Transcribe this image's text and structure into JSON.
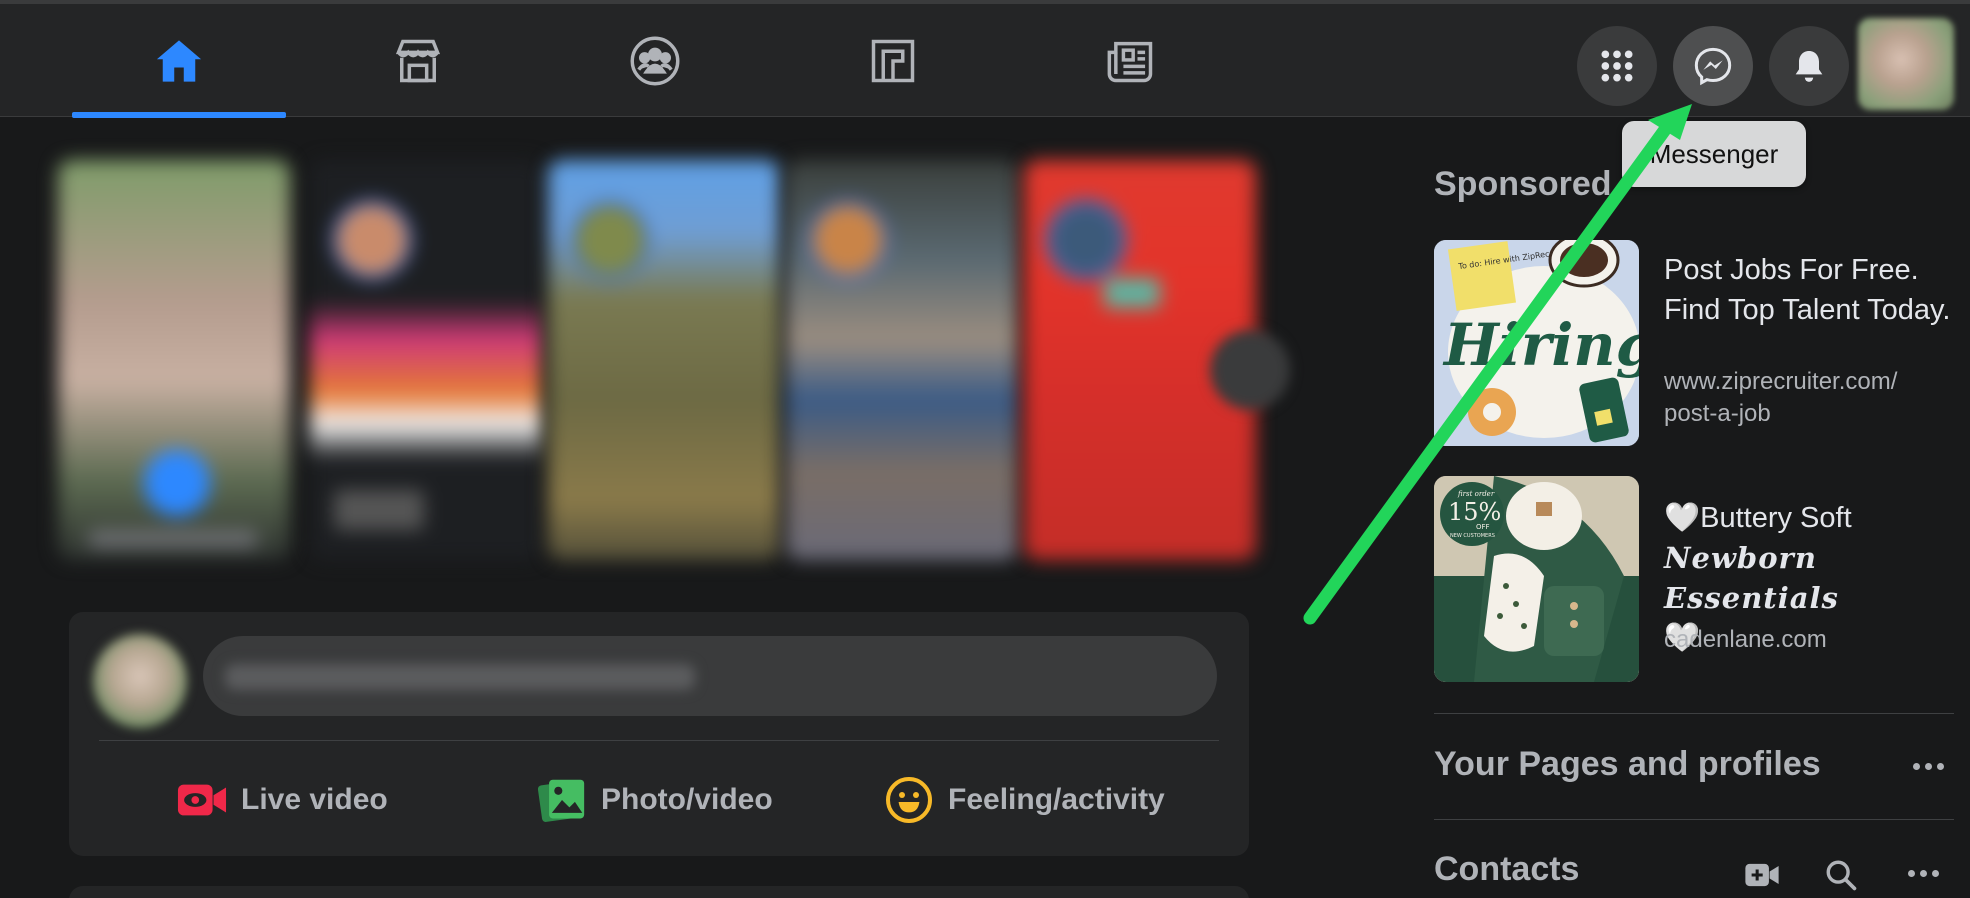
{
  "nav": {
    "tabs": [
      {
        "name": "home",
        "active": true
      },
      {
        "name": "marketplace",
        "active": false
      },
      {
        "name": "groups",
        "active": false
      },
      {
        "name": "gaming",
        "active": false
      },
      {
        "name": "news",
        "active": false
      }
    ],
    "right_buttons": [
      "menu-grid-icon",
      "messenger-icon",
      "notifications-bell-icon",
      "account-avatar"
    ],
    "tooltip": "Messenger"
  },
  "composer": {
    "actions": [
      {
        "label": "Live video",
        "icon": "live-video-icon",
        "color": "#f02849"
      },
      {
        "label": "Photo/video",
        "icon": "photo-video-icon",
        "color": "#45bd62"
      },
      {
        "label": "Feeling/activity",
        "icon": "feeling-icon",
        "color": "#f7b928"
      }
    ]
  },
  "sidebar": {
    "sponsored_title": "Sponsored",
    "ads": [
      {
        "title": "Post Jobs For Free. Find Top Talent Today.",
        "url": "www.ziprecruiter.com/ post-a-job",
        "thumb_text": "Hiring?",
        "note_text": "To do: Hire with ZipRecruiter"
      },
      {
        "title_line1": "🤍Buttery Soft",
        "title_line2": "Newborn Essentials",
        "title_line3": "🤍",
        "url": "cadenlane.com",
        "badge_top": "first order",
        "badge_main": "15%",
        "badge_off": "OFF",
        "badge_sub": "NEW CUSTOMERS"
      }
    ],
    "pages_title": "Your Pages and profiles",
    "contacts_title": "Contacts"
  },
  "colors": {
    "accent": "#2d88ff",
    "annotation_arrow": "#22d55a"
  }
}
